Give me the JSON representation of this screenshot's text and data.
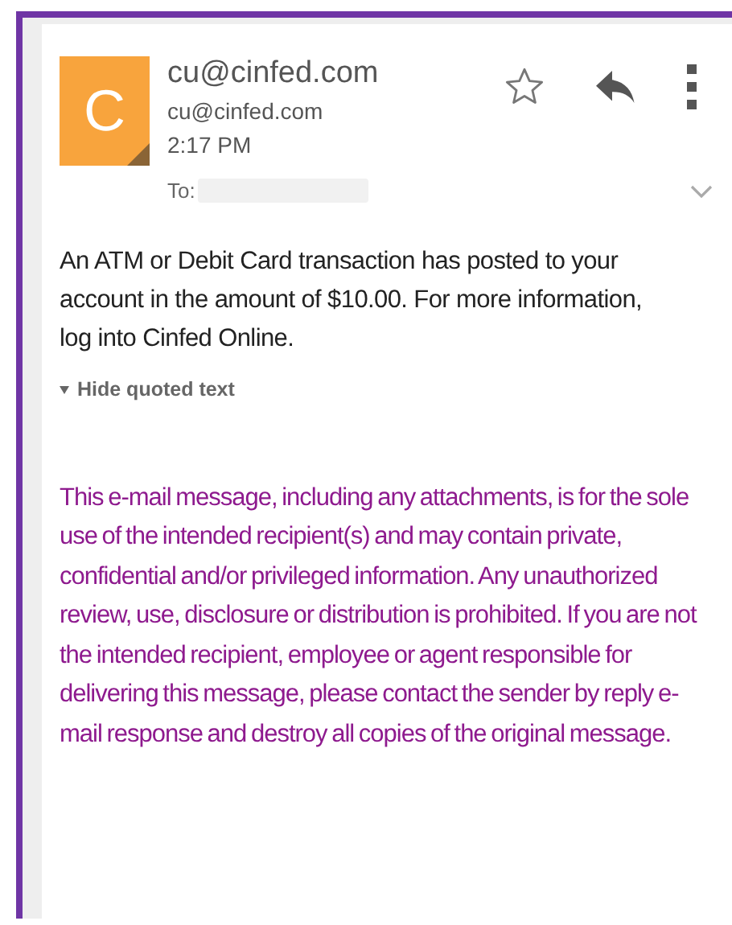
{
  "message": {
    "avatar_letter": "C",
    "sender_name": "cu@cinfed.com",
    "sender_email": "cu@cinfed.com",
    "time": "2:17 PM",
    "to_label": "To:",
    "starred": false,
    "body": "An ATM or Debit Card transaction has posted to your account in the amount of $10.00. For more information, log into Cinfed Online.",
    "quoted_toggle": "Hide quoted text",
    "disclaimer": "This e-mail message, including any attachments, is for the sole use of the intended recipient(s) and may contain private, confidential and/or privileged information. Any unauthorized review, use, disclosure or distribution is prohibited. If you are not the intended recipient, employee or agent responsible for delivering this message, please contact the sender by reply e-mail response and destroy all copies of the original message."
  }
}
